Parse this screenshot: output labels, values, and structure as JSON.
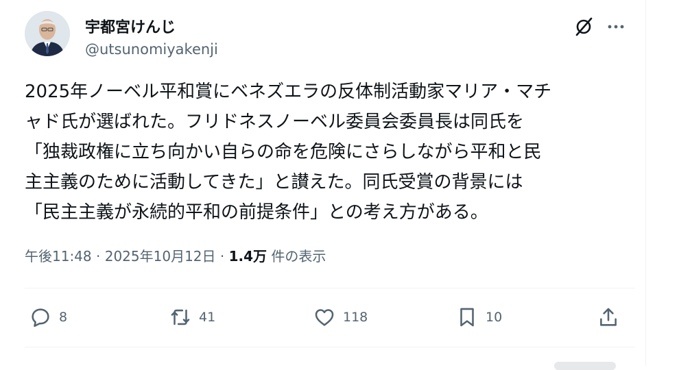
{
  "author": {
    "name": "宇都宮けんじ",
    "handle": "@utsunomiyakenji"
  },
  "post": {
    "lines": [
      "2025年ノーベル平和賞にベネズエラの反体制活動家マリア・マチ",
      "ャド氏が選ばれた。フリドネスノーベル委員会委員長は同氏を",
      "「独裁政権に立ち向かい自らの命を危険にさらしながら平和と民",
      "主主義のために活動してきた」と讃えた。同氏受賞の背景には",
      "「民主主義が永続的平和の前提条件」との考え方がある。"
    ]
  },
  "meta": {
    "time": "午後11:48",
    "sep1": " · ",
    "date": "2025年10月12日",
    "sep2": " · ",
    "views": "1.4万",
    "views_label": " 件の表示"
  },
  "actions": {
    "replies": "8",
    "reposts": "41",
    "likes": "118",
    "bookmarks": "10"
  },
  "icons": {
    "grok": "grok-icon",
    "more": "more-icon",
    "reply": "reply-icon",
    "repost": "repost-icon",
    "like": "heart-icon",
    "bookmark": "bookmark-icon",
    "share": "share-icon"
  },
  "colors": {
    "text": "#0f1419",
    "secondary": "#536471",
    "divider": "#eff3f4"
  }
}
